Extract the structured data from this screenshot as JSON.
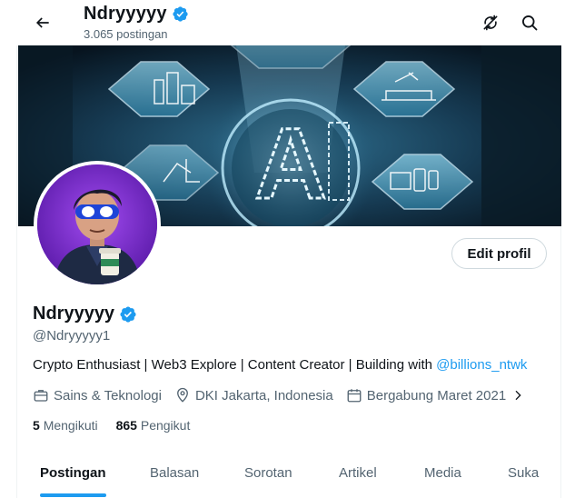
{
  "header": {
    "name": "Ndryyyyy",
    "post_count": "3.065 postingan"
  },
  "profile": {
    "name": "Ndryyyyy",
    "handle": "@Ndryyyyy1",
    "bio_text": "Crypto Enthusiast | Web3 Explore | Content Creator | Building with ",
    "bio_link": "@billions_ntwk",
    "category": "Sains & Teknologi",
    "location": "DKI Jakarta, Indonesia",
    "joined": "Bergabung Maret 2021",
    "following_count": "5",
    "following_label": "Mengikuti",
    "followers_count": "865",
    "followers_label": "Pengikut",
    "edit_label": "Edit profil",
    "verified_color": "#1d9bf0"
  },
  "banner": {
    "center_letter": "A"
  },
  "tabs": [
    {
      "label": "Postingan",
      "active": true
    },
    {
      "label": "Balasan",
      "active": false
    },
    {
      "label": "Sorotan",
      "active": false
    },
    {
      "label": "Artikel",
      "active": false
    },
    {
      "label": "Media",
      "active": false
    },
    {
      "label": "Suka",
      "active": false
    }
  ],
  "icons": {
    "back": "arrow-left-icon",
    "refresh": "refresh-off-icon",
    "search": "search-icon",
    "verified": "verified-badge-icon",
    "category": "briefcase-icon",
    "location": "location-pin-icon",
    "joined": "calendar-icon",
    "more": "chevron-right-icon"
  }
}
